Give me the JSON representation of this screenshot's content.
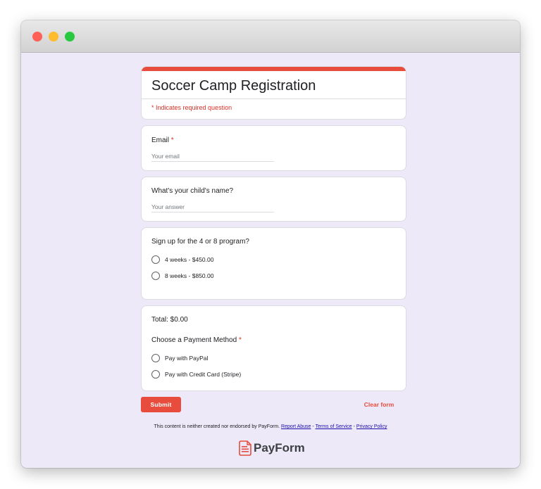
{
  "form": {
    "title": "Soccer Camp Registration",
    "required_note": "* Indicates required question"
  },
  "email": {
    "label": "Email",
    "required_marker": "*",
    "placeholder": "Your email",
    "value": ""
  },
  "child_name": {
    "label": "What's your child's name?",
    "placeholder": "Your answer",
    "value": ""
  },
  "program": {
    "label": "Sign up for the 4 or 8 program?",
    "options": [
      {
        "label": "4 weeks - $450.00",
        "selected": false
      },
      {
        "label": "8 weeks - $850.00",
        "selected": false
      }
    ]
  },
  "payment": {
    "total": "Total: $0.00",
    "label": "Choose a Payment Method",
    "required_marker": "*",
    "options": [
      {
        "label": "Pay with PayPal",
        "selected": false
      },
      {
        "label": "Pay with Credit Card (Stripe)",
        "selected": false
      }
    ]
  },
  "actions": {
    "submit_label": "Submit",
    "clear_label": "Clear form"
  },
  "footer": {
    "disclaimer": "This content is neither created nor endorsed by PayForm.",
    "report_abuse": "Report Abuse",
    "separator_1": " - ",
    "terms": "Terms of Service",
    "separator_2": " - ",
    "privacy": "Privacy Policy",
    "brand_name": "PayForm",
    "brand_icon": "document-icon"
  },
  "colors": {
    "accent": "#e74c3c",
    "background": "#ede9f8",
    "required": "#d93025",
    "link": "#1a0dab"
  }
}
